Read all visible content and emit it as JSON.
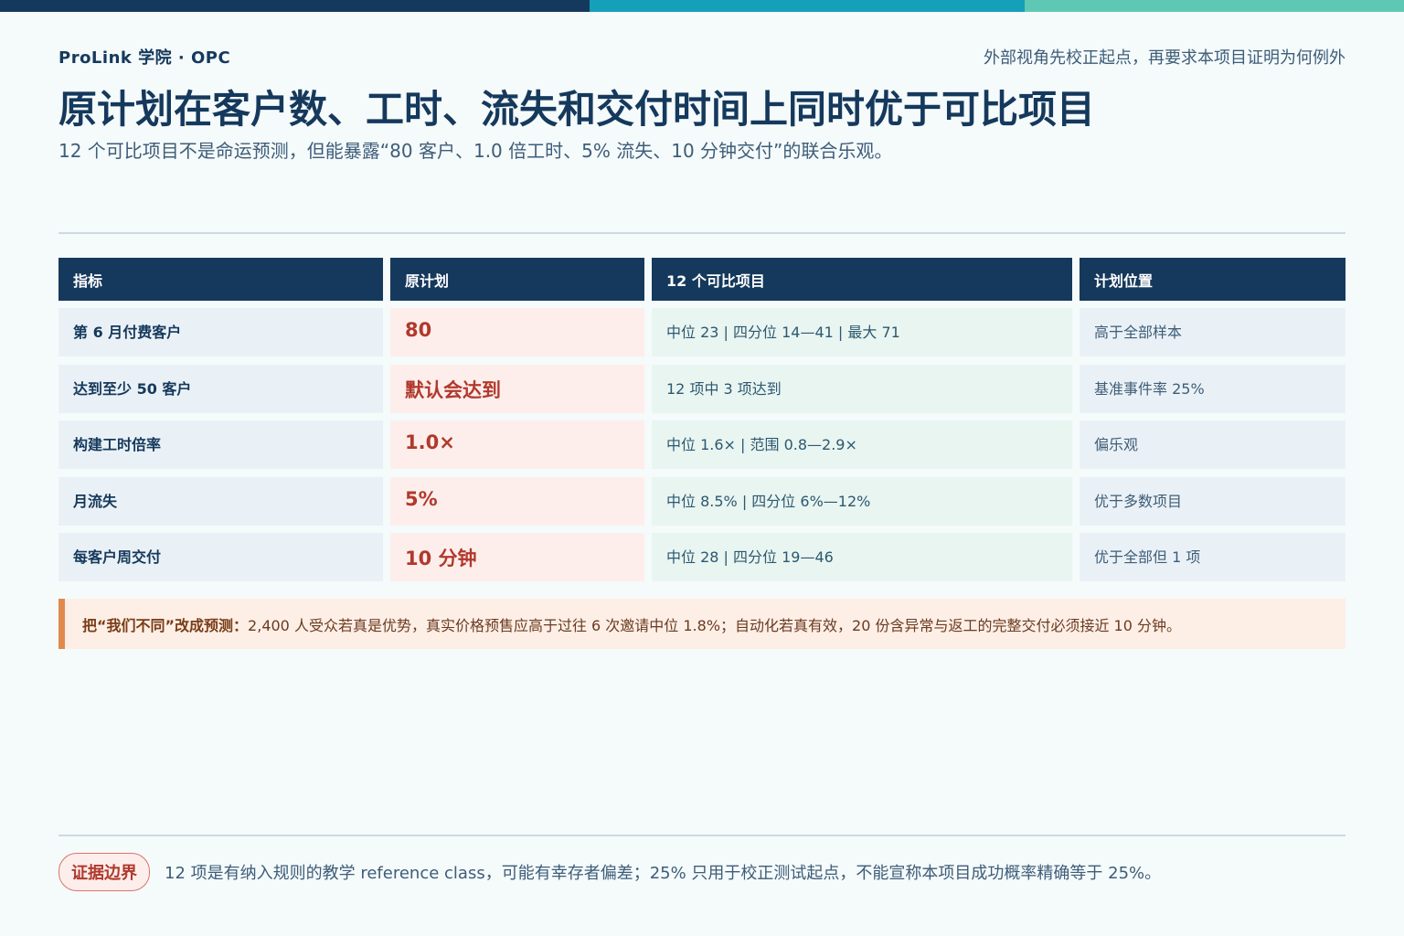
{
  "header": {
    "brand": "ProLink 学院 · OPC",
    "kicker": "外部视角先校正起点，再要求本项目证明为何例外",
    "title": "原计划在客户数、工时、流失和交付时间上同时优于可比项目",
    "subtitle": "12 个可比项目不是命运预测，但能暴露“80 客户、1.0 倍工时、5% 流失、10 分钟交付”的联合乐观。"
  },
  "table": {
    "columns": [
      "指标",
      "原计划",
      "12 个可比项目",
      "计划位置"
    ],
    "rows": [
      {
        "metric": "第 6 月付费客户",
        "plan": "80",
        "comparables": "中位 23 | 四分位 14—41 | 最大 71",
        "position": "高于全部样本"
      },
      {
        "metric": "达到至少 50 客户",
        "plan": "默认会达到",
        "comparables": "12 项中 3 项达到",
        "position": "基准事件率 25%"
      },
      {
        "metric": "构建工时倍率",
        "plan": "1.0×",
        "comparables": "中位 1.6× | 范围 0.8—2.9×",
        "position": "偏乐观"
      },
      {
        "metric": "月流失",
        "plan": "5%",
        "comparables": "中位 8.5% | 四分位 6%—12%",
        "position": "优于多数项目"
      },
      {
        "metric": "每客户周交付",
        "plan": "10 分钟",
        "comparables": "中位 28 | 四分位 19—46",
        "position": "优于全部但 1 项"
      }
    ]
  },
  "callout": {
    "lead": "把“我们不同”改成预测：",
    "text": "2,400 人受众若真是优势，真实价格预售应高于过往 6 次邀请中位 1.8%；自动化若真有效，20 份含异常与返工的完整交付必须接近 10 分钟。"
  },
  "footer": {
    "badge": "证据边界",
    "note": "12 项是有纳入规则的教学 reference class，可能有幸存者偏差；25% 只用于校正测试起点，不能宣称本项目成功概率精确等于 25%。"
  },
  "colors": {
    "navy": "#15395c",
    "teal": "#14a0b8",
    "mint": "#5ec8b4",
    "plan_red": "#b0392c",
    "callout_orange": "#e08a4e"
  }
}
